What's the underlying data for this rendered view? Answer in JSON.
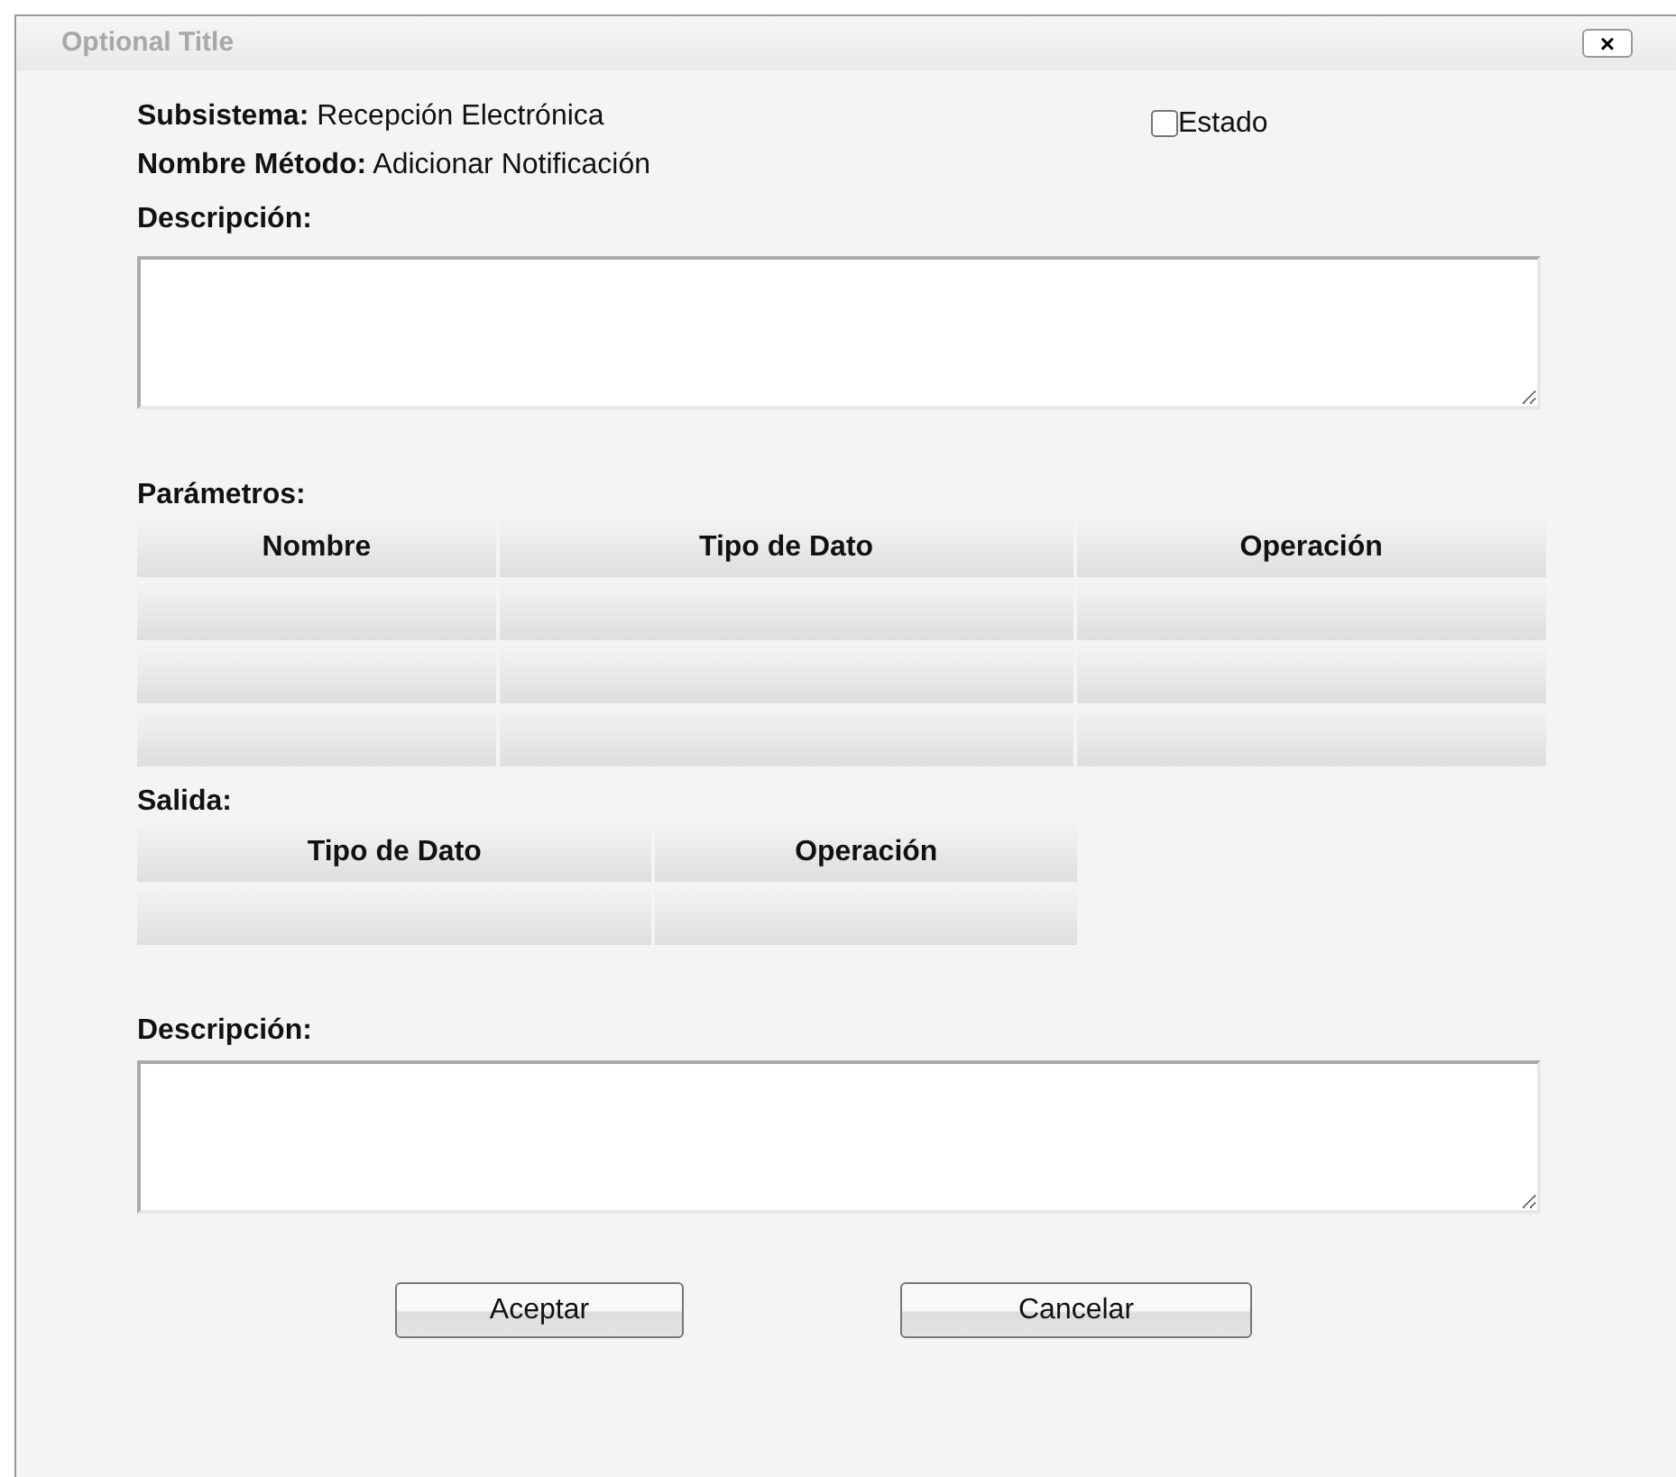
{
  "window": {
    "title": "Optional Title",
    "close": "×"
  },
  "subsistema": {
    "label": "Subsistema:",
    "value": "Recepción Electrónica"
  },
  "estado": {
    "label": "Estado",
    "checked": false
  },
  "metodo": {
    "label": "Nombre Método:",
    "value": "Adicionar Notificación"
  },
  "descripcion": {
    "label": "Descripción:"
  },
  "parametros": {
    "label": "Parámetros:",
    "columns": [
      "Nombre",
      "Tipo de Dato",
      "Operación"
    ],
    "rows": [
      {
        "kind": "blank"
      },
      {
        "kind": "blank"
      },
      {
        "kind": "blank"
      }
    ]
  },
  "salida": {
    "label": "Salida:",
    "columns": [
      "Tipo de Dato",
      "Operación"
    ],
    "rows": [
      {
        "kind": "blank"
      }
    ]
  },
  "descripcion_salida": {
    "label": "Descripción:"
  },
  "buttons": [
    "Aceptar",
    "Cancelar"
  ]
}
